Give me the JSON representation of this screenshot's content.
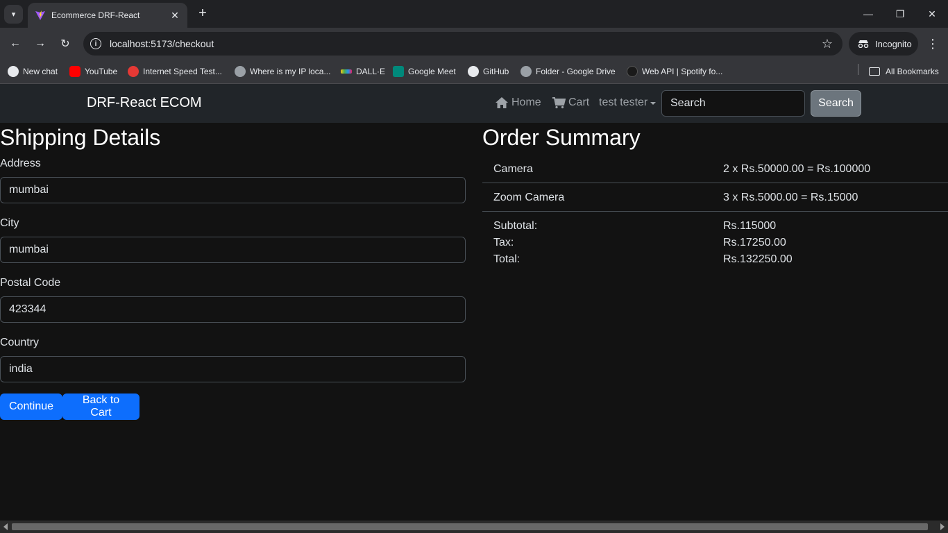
{
  "browser": {
    "tab_title": "Ecommerce DRF-React",
    "url_host": "localhost",
    "url_rest": ":5173/checkout",
    "incognito_label": "Incognito",
    "bookmarks": [
      {
        "label": "New chat",
        "icon": "openai-icon",
        "color": "#e8eaed"
      },
      {
        "label": "YouTube",
        "icon": "youtube-icon",
        "color": "#ff0000"
      },
      {
        "label": "Internet Speed Test...",
        "icon": "speedtest-icon",
        "color": "#e53935"
      },
      {
        "label": "Where is my IP loca...",
        "icon": "globe-icon",
        "color": "#9aa0a6"
      },
      {
        "label": "DALL·E",
        "icon": "dalle-icon",
        "color": "#f5c518"
      },
      {
        "label": "Google Meet",
        "icon": "meet-icon",
        "color": "#00897b"
      },
      {
        "label": "GitHub",
        "icon": "github-icon",
        "color": "#e8eaed"
      },
      {
        "label": "Folder - Google Drive",
        "icon": "globe-icon",
        "color": "#9aa0a6"
      },
      {
        "label": "Web API | Spotify fo...",
        "icon": "spotify-icon",
        "color": "#1a1a1a"
      }
    ],
    "all_bookmarks": "All Bookmarks"
  },
  "navbar": {
    "brand": "DRF-React ECOM",
    "home": "Home",
    "cart": "Cart",
    "user": "test tester",
    "search_placeholder": "Search",
    "search_button": "Search"
  },
  "shipping": {
    "title": "Shipping Details",
    "address_label": "Address",
    "address_value": "mumbai",
    "city_label": "City",
    "city_value": "mumbai",
    "postal_label": "Postal Code",
    "postal_value": "423344",
    "country_label": "Country",
    "country_value": "india",
    "continue_button": "Continue",
    "back_button": "Back to Cart"
  },
  "summary": {
    "title": "Order Summary",
    "items": [
      {
        "name": "Camera",
        "line": "2 x Rs.50000.00 = Rs.100000"
      },
      {
        "name": "Zoom Camera",
        "line": "3 x Rs.5000.00 = Rs.15000"
      }
    ],
    "subtotal_label": "Subtotal:",
    "subtotal_value": "Rs.115000",
    "tax_label": "Tax:",
    "tax_value": "Rs.17250.00",
    "total_label": "Total:",
    "total_value": "Rs.132250.00"
  },
  "colors": {
    "primary": "#0d6efd",
    "navbar_bg": "#212529",
    "page_bg": "#121212"
  }
}
